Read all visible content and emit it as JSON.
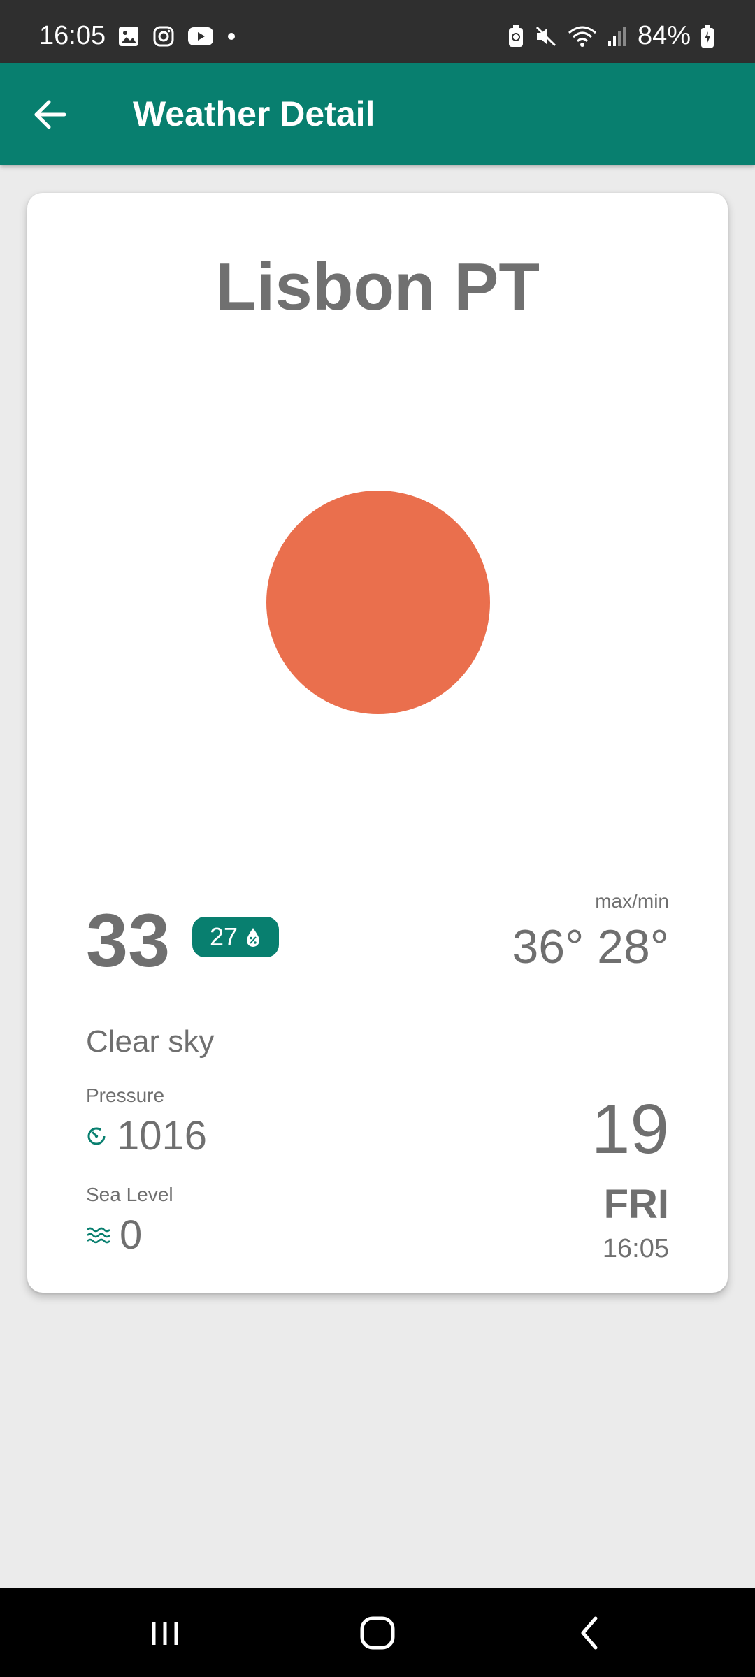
{
  "status_bar": {
    "time": "16:05",
    "battery": "84%",
    "left_icons": [
      "gallery-icon",
      "instagram-icon",
      "youtube-icon",
      "dot-icon"
    ],
    "right_icons": [
      "battery-saver-icon",
      "mute-icon",
      "wifi-icon",
      "signal-icon",
      "battery-icon"
    ]
  },
  "app_bar": {
    "title": "Weather Detail",
    "back_icon": "arrow-left-icon"
  },
  "weather": {
    "city": "Lisbon PT",
    "temperature": "33",
    "feels_like": "27",
    "maxmin_label": "max/min",
    "maxmin": "36° 28°",
    "condition": "Clear sky",
    "pressure_label": "Pressure",
    "pressure_value": "1016",
    "sea_level_label": "Sea Level",
    "sea_level_value": "0",
    "day_number": "19",
    "weekday": "FRI",
    "time": "16:05"
  },
  "colors": {
    "app_bar": "#087f6f",
    "sun": "#ea6f4d",
    "text": "#6f6f6f",
    "background": "#ebebeb"
  },
  "nav_bar": {
    "icons": [
      "recents-icon",
      "home-icon",
      "back-icon"
    ]
  }
}
